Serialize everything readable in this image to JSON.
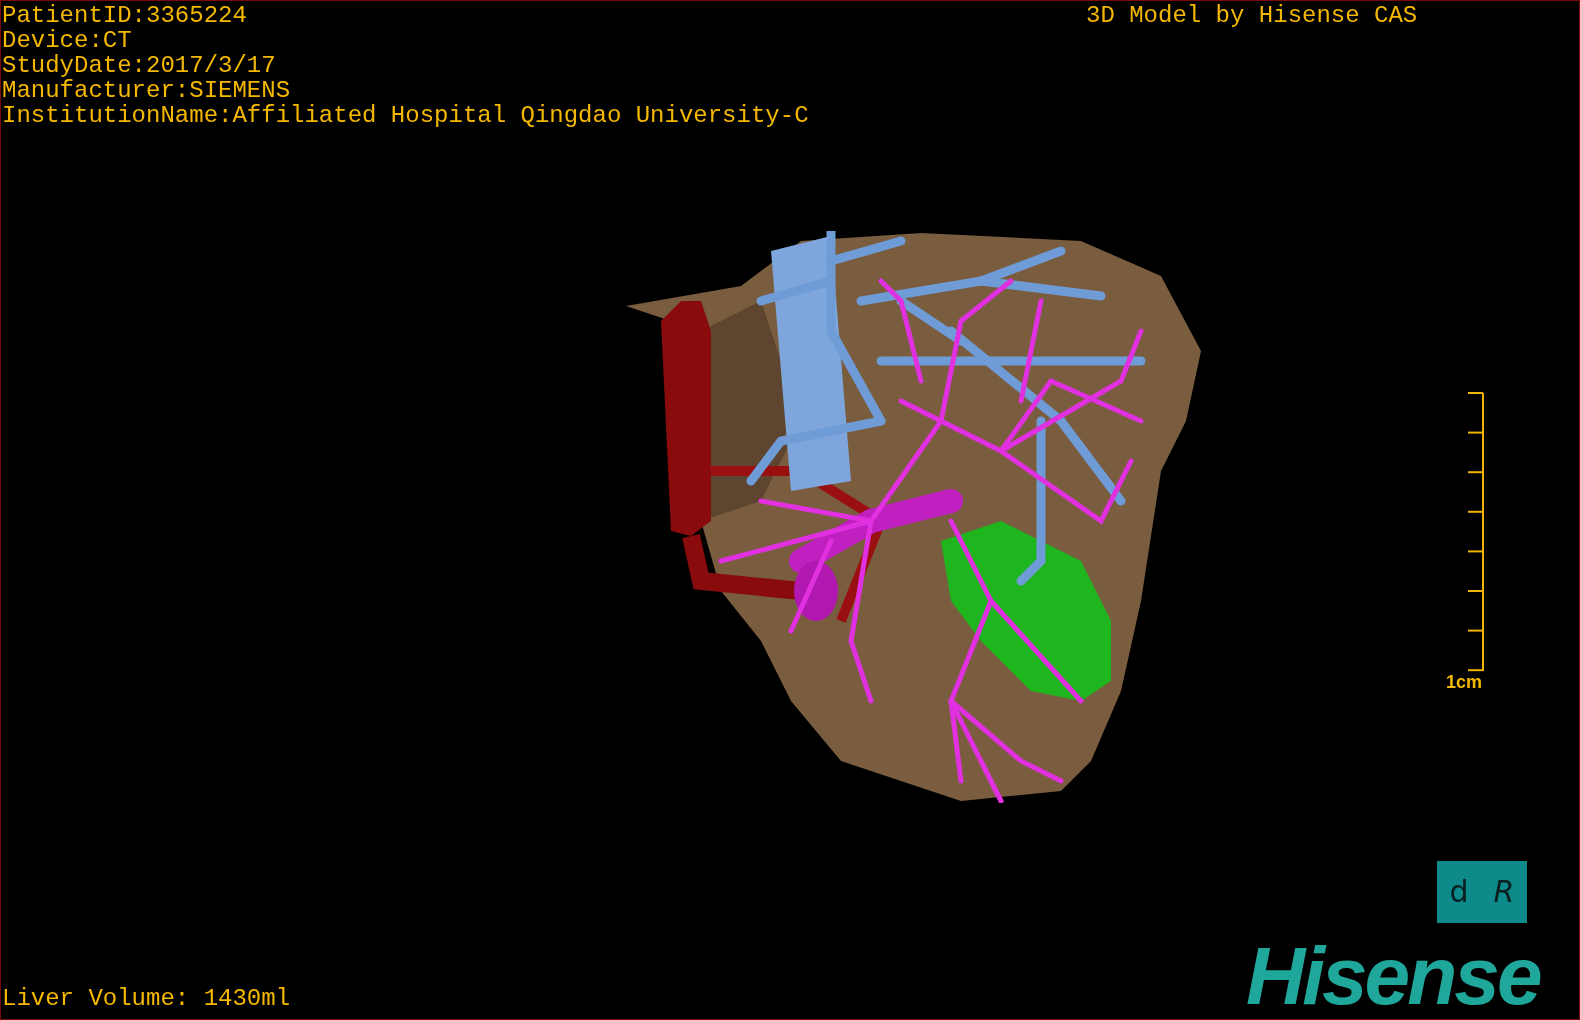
{
  "patient_info": [
    "PatientID:3365224",
    "Device:CT",
    "StudyDate:2017/3/17",
    "Manufacturer:SIEMENS",
    "InstitutionName:Affiliated Hospital Qingdao University-C"
  ],
  "title": "3D Model by Hisense CAS",
  "scale_bar": {
    "label": "1cm"
  },
  "orientation_cube": {
    "faces": [
      {
        "label": "d",
        "kind": "plain"
      },
      {
        "label": "R",
        "kind": "flipped"
      }
    ]
  },
  "liver_volume": "Liver Volume: 1430ml",
  "logo": "Hisense"
}
